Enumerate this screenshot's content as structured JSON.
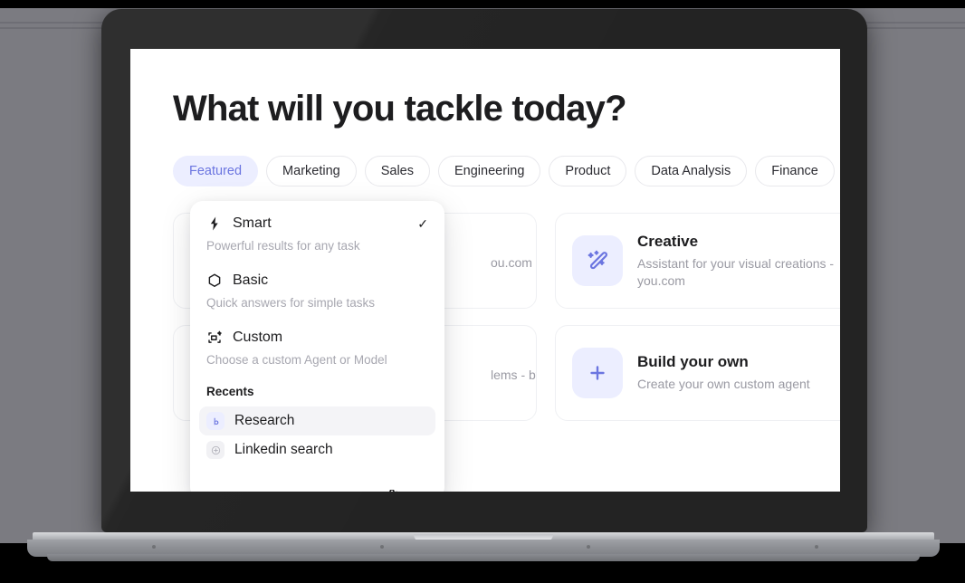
{
  "page": {
    "heading": "What will you tackle today?"
  },
  "tabs": [
    {
      "label": "Featured",
      "active": true
    },
    {
      "label": "Marketing",
      "active": false
    },
    {
      "label": "Sales",
      "active": false
    },
    {
      "label": "Engineering",
      "active": false
    },
    {
      "label": "Product",
      "active": false
    },
    {
      "label": "Data Analysis",
      "active": false
    },
    {
      "label": "Finance",
      "active": false
    }
  ],
  "cards": [
    {
      "title": "",
      "desc": "ou.com",
      "icon": "hidden-icon",
      "obscured": true
    },
    {
      "title": "Creative",
      "desc": "Assistant for your visual creations - you.com",
      "icon": "magic-wand-icon",
      "obscured": false
    },
    {
      "title": "",
      "desc": "lems - by",
      "icon": "hidden-icon",
      "obscured": true
    },
    {
      "title": "Build your own",
      "desc": "Create your own custom agent",
      "icon": "plus-icon",
      "obscured": false
    }
  ],
  "dropdown": {
    "options": [
      {
        "label": "Smart",
        "sub": "Powerful results for any task",
        "icon": "lightning-bolt-icon",
        "checked": true,
        "check_glyph": "✓"
      },
      {
        "label": "Basic",
        "sub": "Quick answers for simple tasks",
        "icon": "hexagon-icon",
        "checked": false,
        "check_glyph": ""
      },
      {
        "label": "Custom",
        "sub": "Choose a custom Agent or Model",
        "icon": "custom-agent-icon",
        "checked": false,
        "check_glyph": ""
      }
    ],
    "recents_title": "Recents",
    "recents": [
      {
        "label": "Research",
        "icon": "research-icon",
        "hovered": true
      },
      {
        "label": "Linkedin search",
        "icon": "linkedin-icon",
        "hovered": false
      }
    ]
  },
  "colors": {
    "accent": "#6b75e0",
    "accent_bg": "#eceeff",
    "text": "#1d1d1f",
    "muted": "#9a9aa3",
    "bezel": "#232323",
    "backdrop": "#7b7b81"
  }
}
